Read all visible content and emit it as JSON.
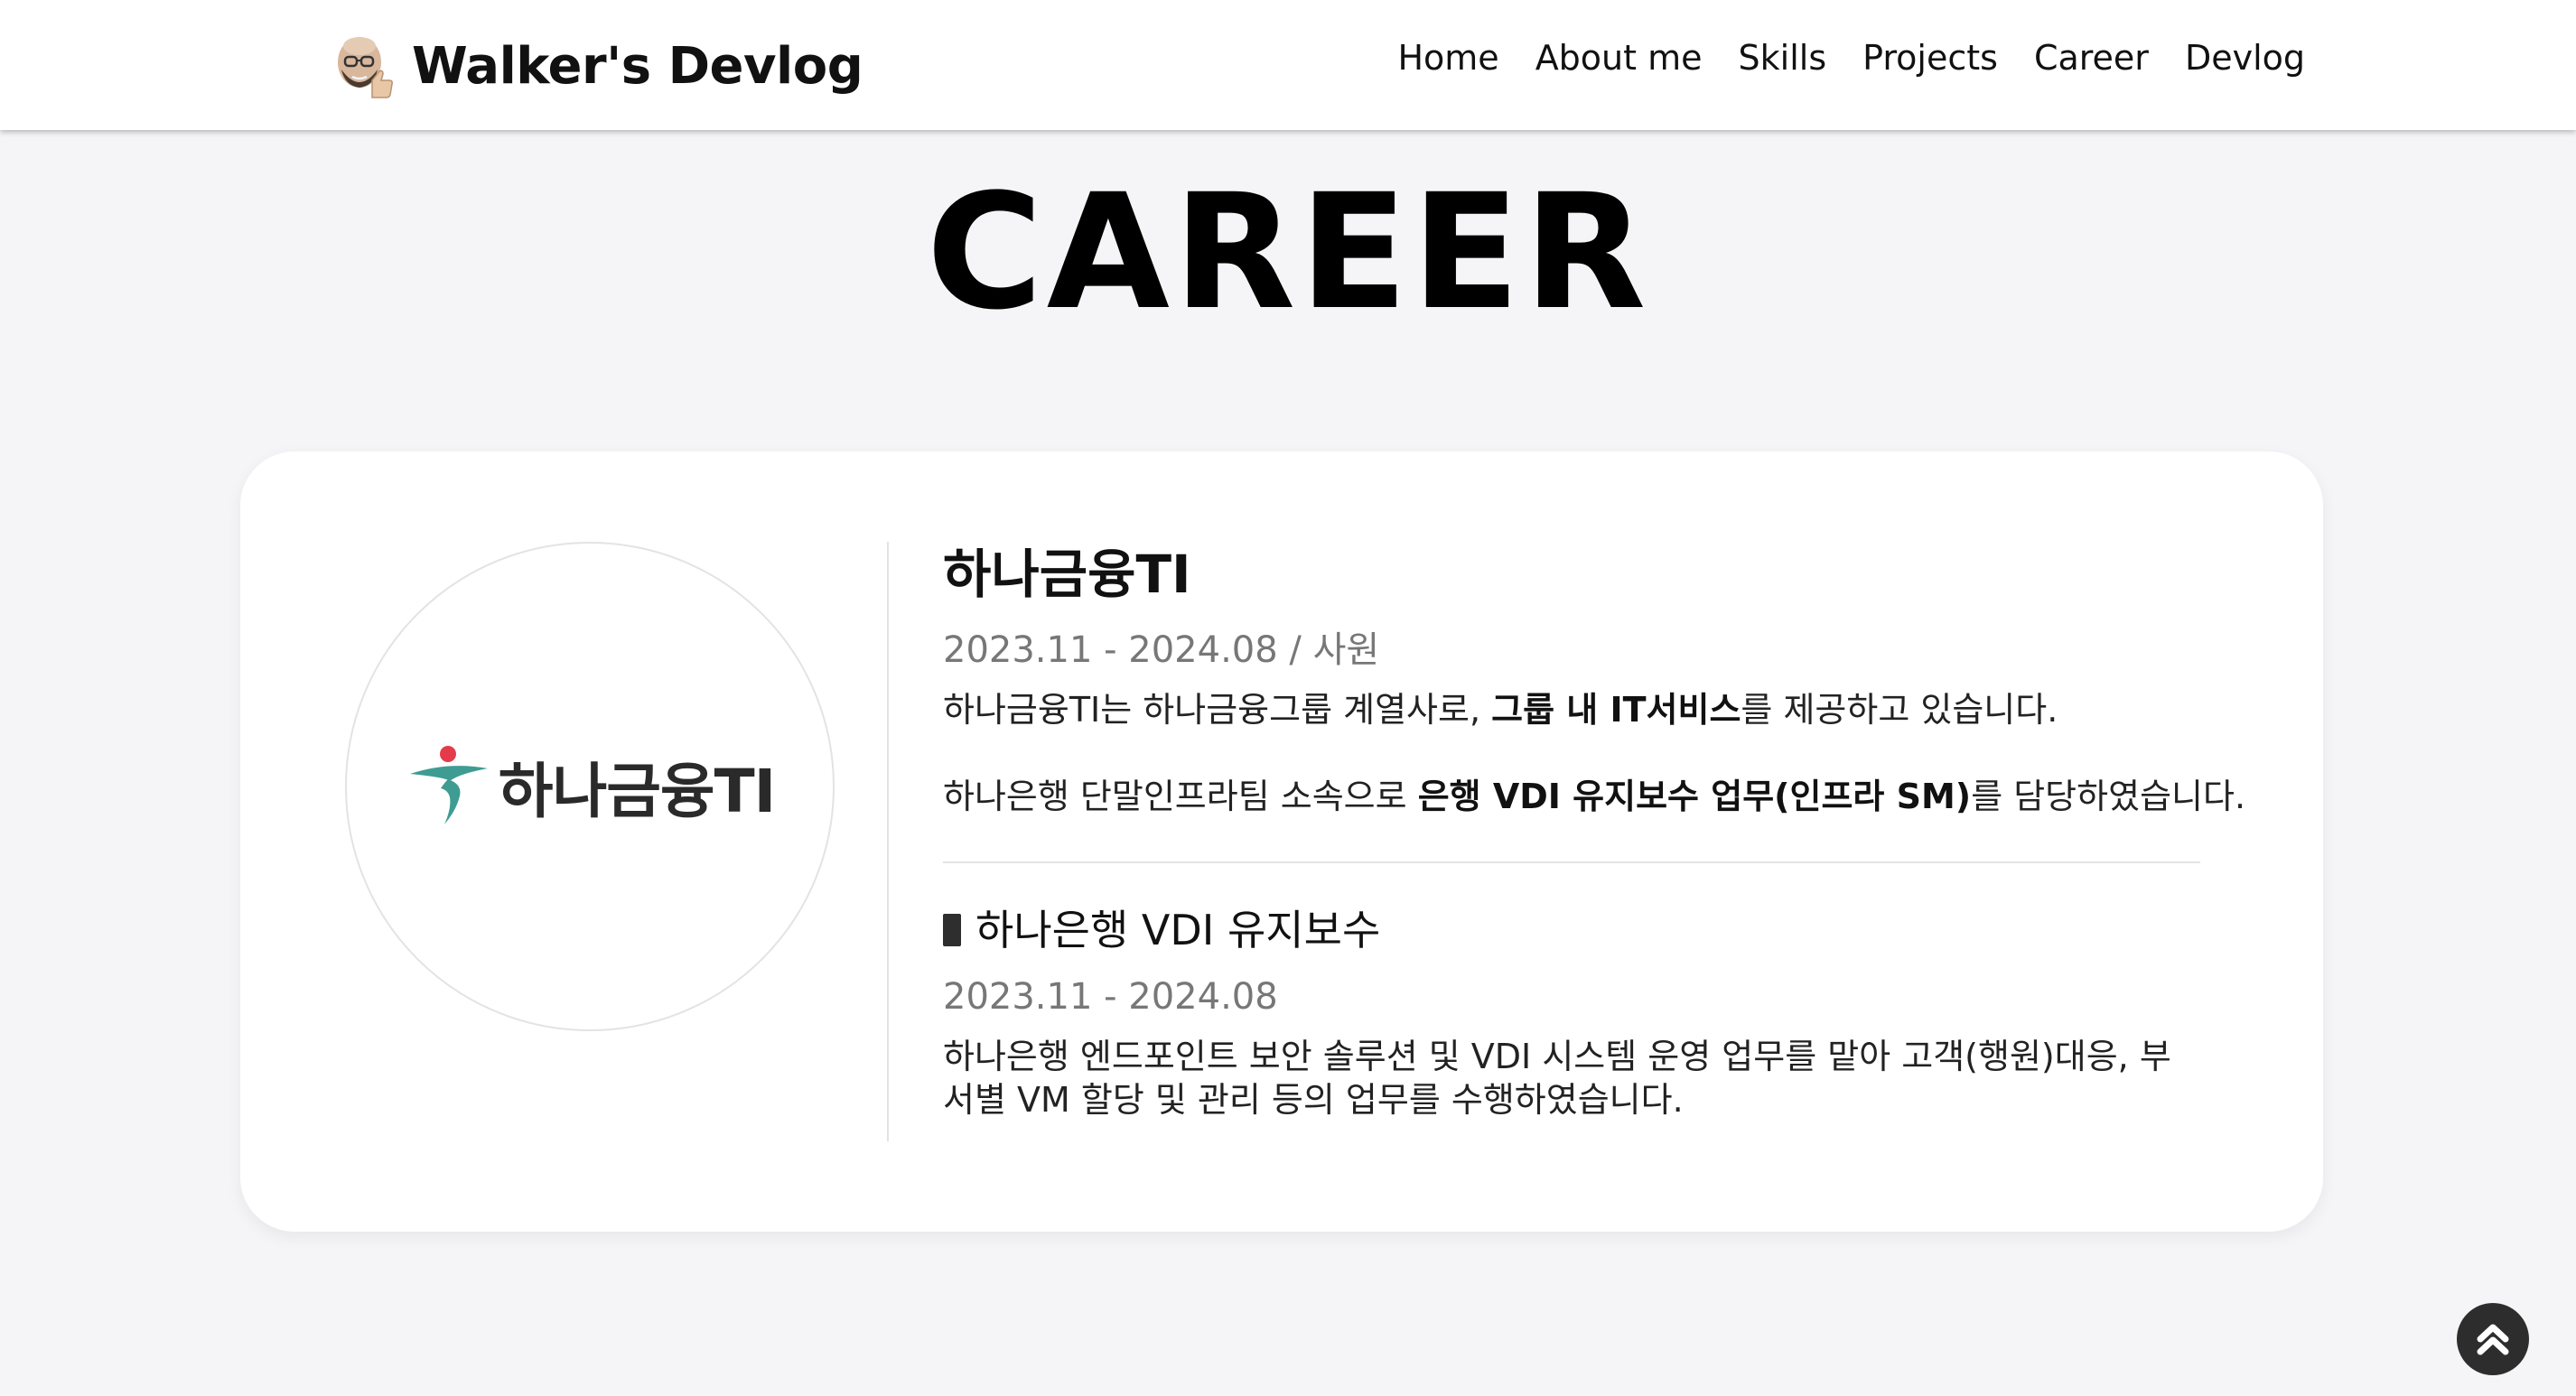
{
  "header": {
    "avatar_icon": "memoji-avatar-icon",
    "site_title": "Walker's Devlog",
    "nav": [
      "Home",
      "About me",
      "Skills",
      "Projects",
      "Career",
      "Devlog"
    ]
  },
  "page": {
    "title": "CAREER"
  },
  "career": {
    "logo_icon": "hana-financial-logo-icon",
    "logo_text": "하나금융TI",
    "company": "하나금융TI",
    "period": "2023.11 - 2024.08 / 사원",
    "desc1": {
      "pre": "하나금융TI는 하나금융그룹 계열사로, ",
      "bold": "그룹 내 IT서비스",
      "post": "를 제공하고 있습니다."
    },
    "desc2": {
      "pre": "하나은행 단말인프라팀 소속으로 ",
      "bold": "은행 VDI 유지보수 업무(인프라 SM)",
      "post": "를 담당하였습니다."
    },
    "project": {
      "bullet_icon": "black-square-bullet-icon",
      "title": "하나은행 VDI 유지보수",
      "period": "2023.11 - 2024.08",
      "desc": "하나은행 엔드포인트 보안 솔루션 및 VDI 시스템 운영 업무를 맡아 고객(행원)대응, 부서별 VM 할당 및 관리 등의 업무를 수행하였습니다."
    }
  },
  "scroll_top": {
    "icon": "double-chevron-up-icon"
  },
  "colors": {
    "background": "#f5f5f7",
    "card": "#ffffff",
    "muted_text": "#777777",
    "logo_teal": "#3e9c93",
    "logo_red": "#e33b4b",
    "scroll_button": "#2d2d2d"
  }
}
